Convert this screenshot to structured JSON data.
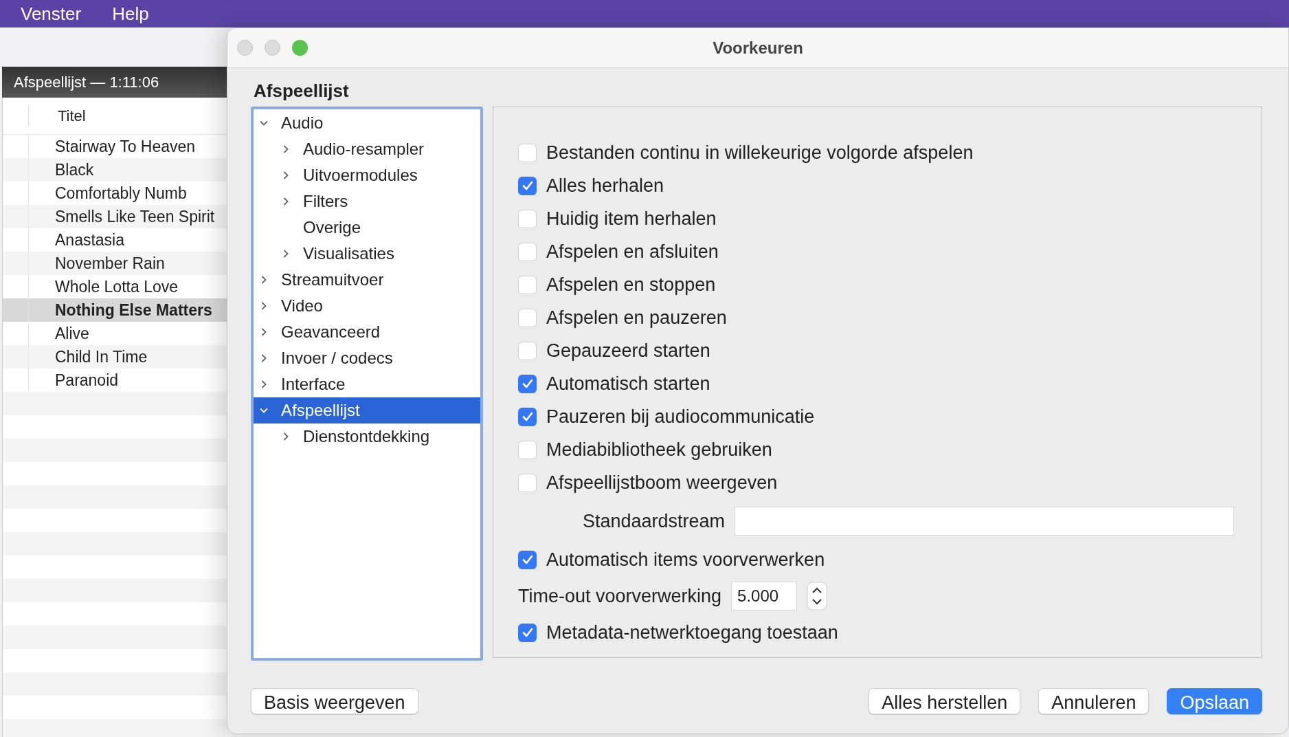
{
  "menu_bar": {
    "items": [
      "Venster",
      "Help"
    ]
  },
  "playlist": {
    "title": "Afspeellijst — 1:11:06",
    "column": "Titel",
    "rows": [
      {
        "title": "Stairway To Heaven",
        "selected": false
      },
      {
        "title": "Black",
        "selected": false
      },
      {
        "title": "Comfortably Numb",
        "selected": false
      },
      {
        "title": "Smells Like Teen Spirit",
        "selected": false
      },
      {
        "title": "Anastasia",
        "selected": false
      },
      {
        "title": "November Rain",
        "selected": false
      },
      {
        "title": "Whole Lotta Love",
        "selected": false
      },
      {
        "title": "Nothing Else Matters",
        "selected": true
      },
      {
        "title": "Alive",
        "selected": false
      },
      {
        "title": "Child In Time",
        "selected": false
      },
      {
        "title": "Paranoid",
        "selected": false
      }
    ]
  },
  "dialog": {
    "title": "Voorkeuren",
    "heading": "Afspeellijst",
    "tree": [
      {
        "label": "Audio",
        "expanded": true,
        "selected": false,
        "children": [
          {
            "label": "Audio-resampler",
            "expanded": false,
            "selected": false
          },
          {
            "label": "Uitvoermodules",
            "expanded": false,
            "selected": false
          },
          {
            "label": "Filters",
            "expanded": false,
            "selected": false
          },
          {
            "label": "Overige",
            "selected": false
          },
          {
            "label": "Visualisaties",
            "expanded": false,
            "selected": false
          }
        ]
      },
      {
        "label": "Streamuitvoer",
        "expanded": false,
        "selected": false
      },
      {
        "label": "Video",
        "expanded": false,
        "selected": false
      },
      {
        "label": "Geavanceerd",
        "expanded": false,
        "selected": false
      },
      {
        "label": "Invoer / codecs",
        "expanded": false,
        "selected": false
      },
      {
        "label": "Interface",
        "expanded": false,
        "selected": false
      },
      {
        "label": "Afspeellijst",
        "expanded": true,
        "selected": true,
        "children": [
          {
            "label": "Dienstontdekking",
            "expanded": false,
            "selected": false
          }
        ]
      }
    ],
    "options": [
      {
        "kind": "checkbox",
        "label": "Bestanden continu in willekeurige volgorde afspelen",
        "checked": false
      },
      {
        "kind": "checkbox",
        "label": "Alles herhalen",
        "checked": true
      },
      {
        "kind": "checkbox",
        "label": "Huidig item herhalen",
        "checked": false
      },
      {
        "kind": "checkbox",
        "label": "Afspelen en afsluiten",
        "checked": false
      },
      {
        "kind": "checkbox",
        "label": "Afspelen en stoppen",
        "checked": false
      },
      {
        "kind": "checkbox",
        "label": "Afspelen en pauzeren",
        "checked": false
      },
      {
        "kind": "checkbox",
        "label": "Gepauzeerd starten",
        "checked": false
      },
      {
        "kind": "checkbox",
        "label": "Automatisch starten",
        "checked": true
      },
      {
        "kind": "checkbox",
        "label": "Pauzeren bij audiocommunicatie",
        "checked": true
      },
      {
        "kind": "checkbox",
        "label": "Mediabibliotheek gebruiken",
        "checked": false
      },
      {
        "kind": "checkbox",
        "label": "Afspeellijstboom weergeven",
        "checked": false
      },
      {
        "kind": "text_field",
        "label": "Standaardstream"
      },
      {
        "kind": "checkbox",
        "label": "Automatisch items voorverwerken",
        "checked": true
      },
      {
        "kind": "spin_field",
        "label": "Time-out voorverwerking",
        "value": "5.000"
      },
      {
        "kind": "checkbox",
        "label": "Metadata-netwerktoegang toestaan",
        "checked": true
      }
    ],
    "buttons": [
      {
        "label": "Basis weergeven",
        "kind": "left"
      },
      {
        "label": "Alles herstellen",
        "kind": "normal"
      },
      {
        "label": "Annuleren",
        "kind": "normal"
      },
      {
        "label": "Opslaan",
        "kind": "primary"
      }
    ]
  }
}
